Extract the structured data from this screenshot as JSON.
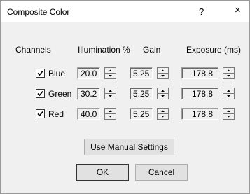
{
  "dialog": {
    "title": "Composite Color",
    "help_glyph": "?",
    "close_glyph": "×"
  },
  "headers": {
    "channels": "Channels",
    "illumination": "Illumination %",
    "gain": "Gain",
    "exposure": "Exposure (ms)"
  },
  "rows": [
    {
      "checked": true,
      "label": "Blue",
      "illumination": "20.0",
      "gain": "5.25",
      "exposure": "178.8"
    },
    {
      "checked": true,
      "label": "Green",
      "illumination": "30.2",
      "gain": "5.25",
      "exposure": "178.8"
    },
    {
      "checked": true,
      "label": "Red",
      "illumination": "40.0",
      "gain": "5.25",
      "exposure": "178.8"
    }
  ],
  "buttons": {
    "manual": "Use Manual Settings",
    "ok": "OK",
    "cancel": "Cancel"
  }
}
